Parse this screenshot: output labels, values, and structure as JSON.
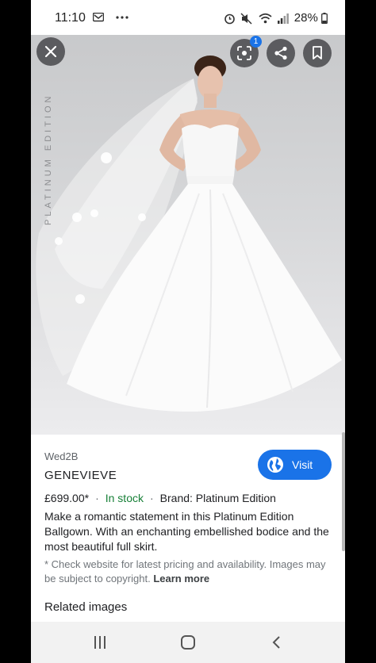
{
  "status_bar": {
    "time": "11:10",
    "notification_icons": [
      "message-icon",
      "more-dots-icon"
    ],
    "system_icons": [
      "alarm-icon",
      "mute-icon",
      "wifi-icon",
      "signal-icon"
    ],
    "battery": "28%"
  },
  "image_viewer": {
    "image_subject": "woman wearing a strapless white ballgown wedding dress with veil",
    "watermark": "PLATINUM EDITION",
    "lens_badge_count": "1",
    "buttons": {
      "close": "close-icon",
      "lens": "lens-icon",
      "share": "share-icon",
      "save": "bookmark-icon"
    }
  },
  "product": {
    "source": "Wed2B",
    "title": "GENEVIEVE",
    "visit_label": "Visit",
    "price": "£699.00*",
    "separator": "·",
    "availability": "In stock",
    "brand": "Brand: Platinum Edition",
    "description": "Make a romantic statement in this Platinum Edition Ballgown. With an enchanting embellished bodice and the most beautiful full skirt.",
    "disclaimer": "* Check website for latest pricing and availability. Images may be subject to copyright.",
    "learn_more": "Learn more",
    "related_heading": "Related images"
  },
  "colors": {
    "accent": "#1a73e8",
    "in_stock": "#188038",
    "text_primary": "#202124",
    "text_secondary": "#5f6368"
  },
  "nav_bar": {
    "recents": "recents-icon",
    "home": "home-icon",
    "back": "back-icon"
  }
}
